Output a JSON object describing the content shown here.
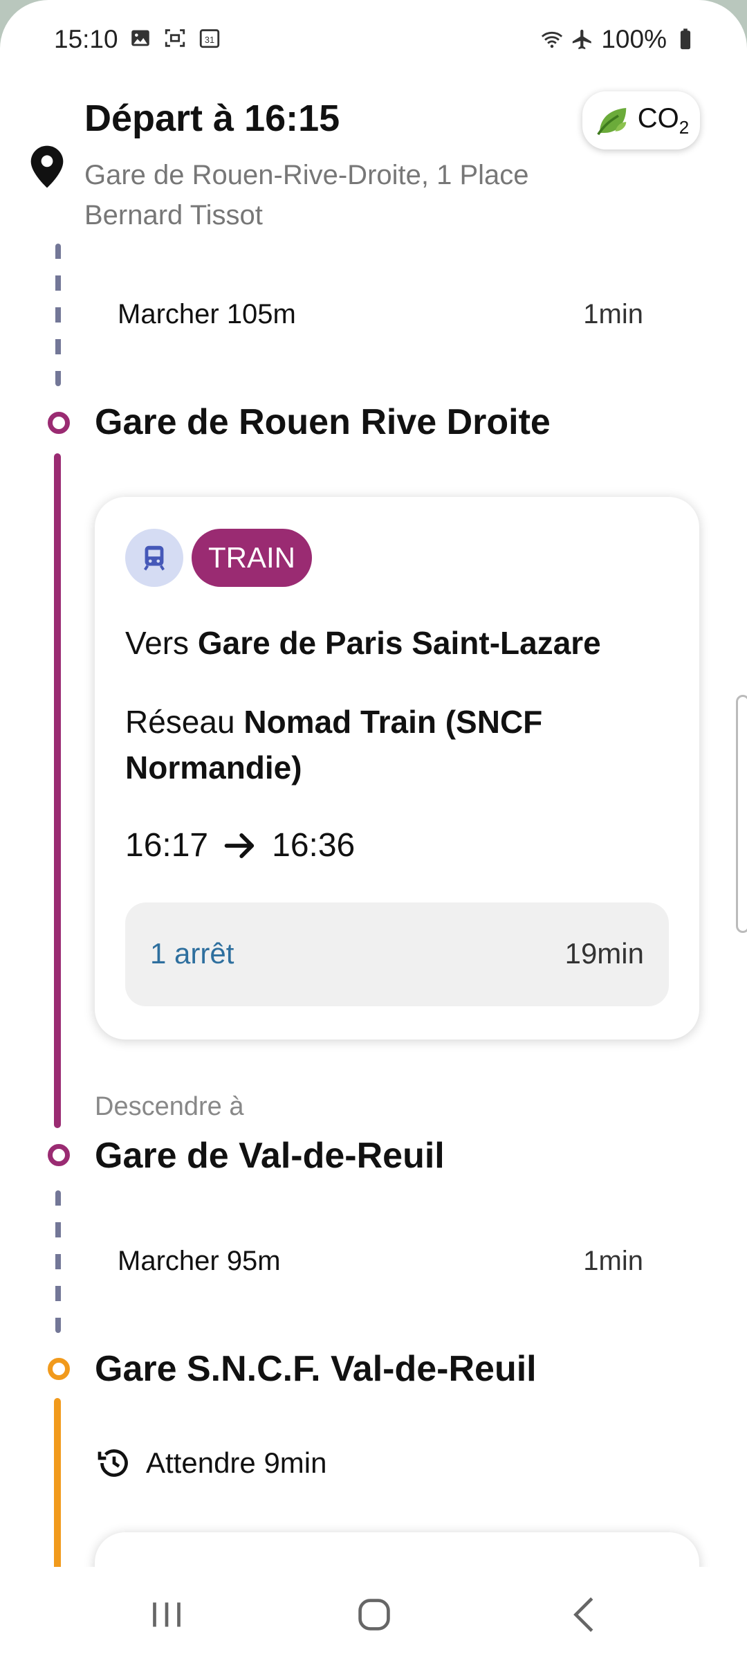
{
  "status_bar": {
    "time": "15:10",
    "battery": "100%"
  },
  "header": {
    "title": "Départ à 16:15",
    "address": "Gare de Rouen-Rive-Droite, 1 Place Bernard Tissot",
    "co2_label": "CO",
    "co2_sub": "2"
  },
  "legs": {
    "walk1": {
      "label": "Marcher 105m",
      "duration": "1min"
    },
    "stop1": "Gare de Rouen Rive Droite",
    "train": {
      "badge": "TRAIN",
      "direction_prefix": "Vers ",
      "direction": "Gare de Paris Saint-Lazare",
      "network_prefix": "Réseau ",
      "network": "Nomad Train (SNCF Normandie)",
      "depart": "16:17",
      "arrive": "16:36",
      "stops": "1 arrêt",
      "duration": "19min"
    },
    "alight_label": "Descendre à",
    "stop2": "Gare de Val-de-Reuil",
    "walk2": {
      "label": "Marcher 95m",
      "duration": "1min"
    },
    "stop3": "Gare S.N.C.F. Val-de-Reuil",
    "wait": "Attendre 9min"
  },
  "colors": {
    "train": "#9a2b72",
    "walk_dash": "#737797",
    "bus": "#f19a1c",
    "link": "#2e6f9e"
  }
}
